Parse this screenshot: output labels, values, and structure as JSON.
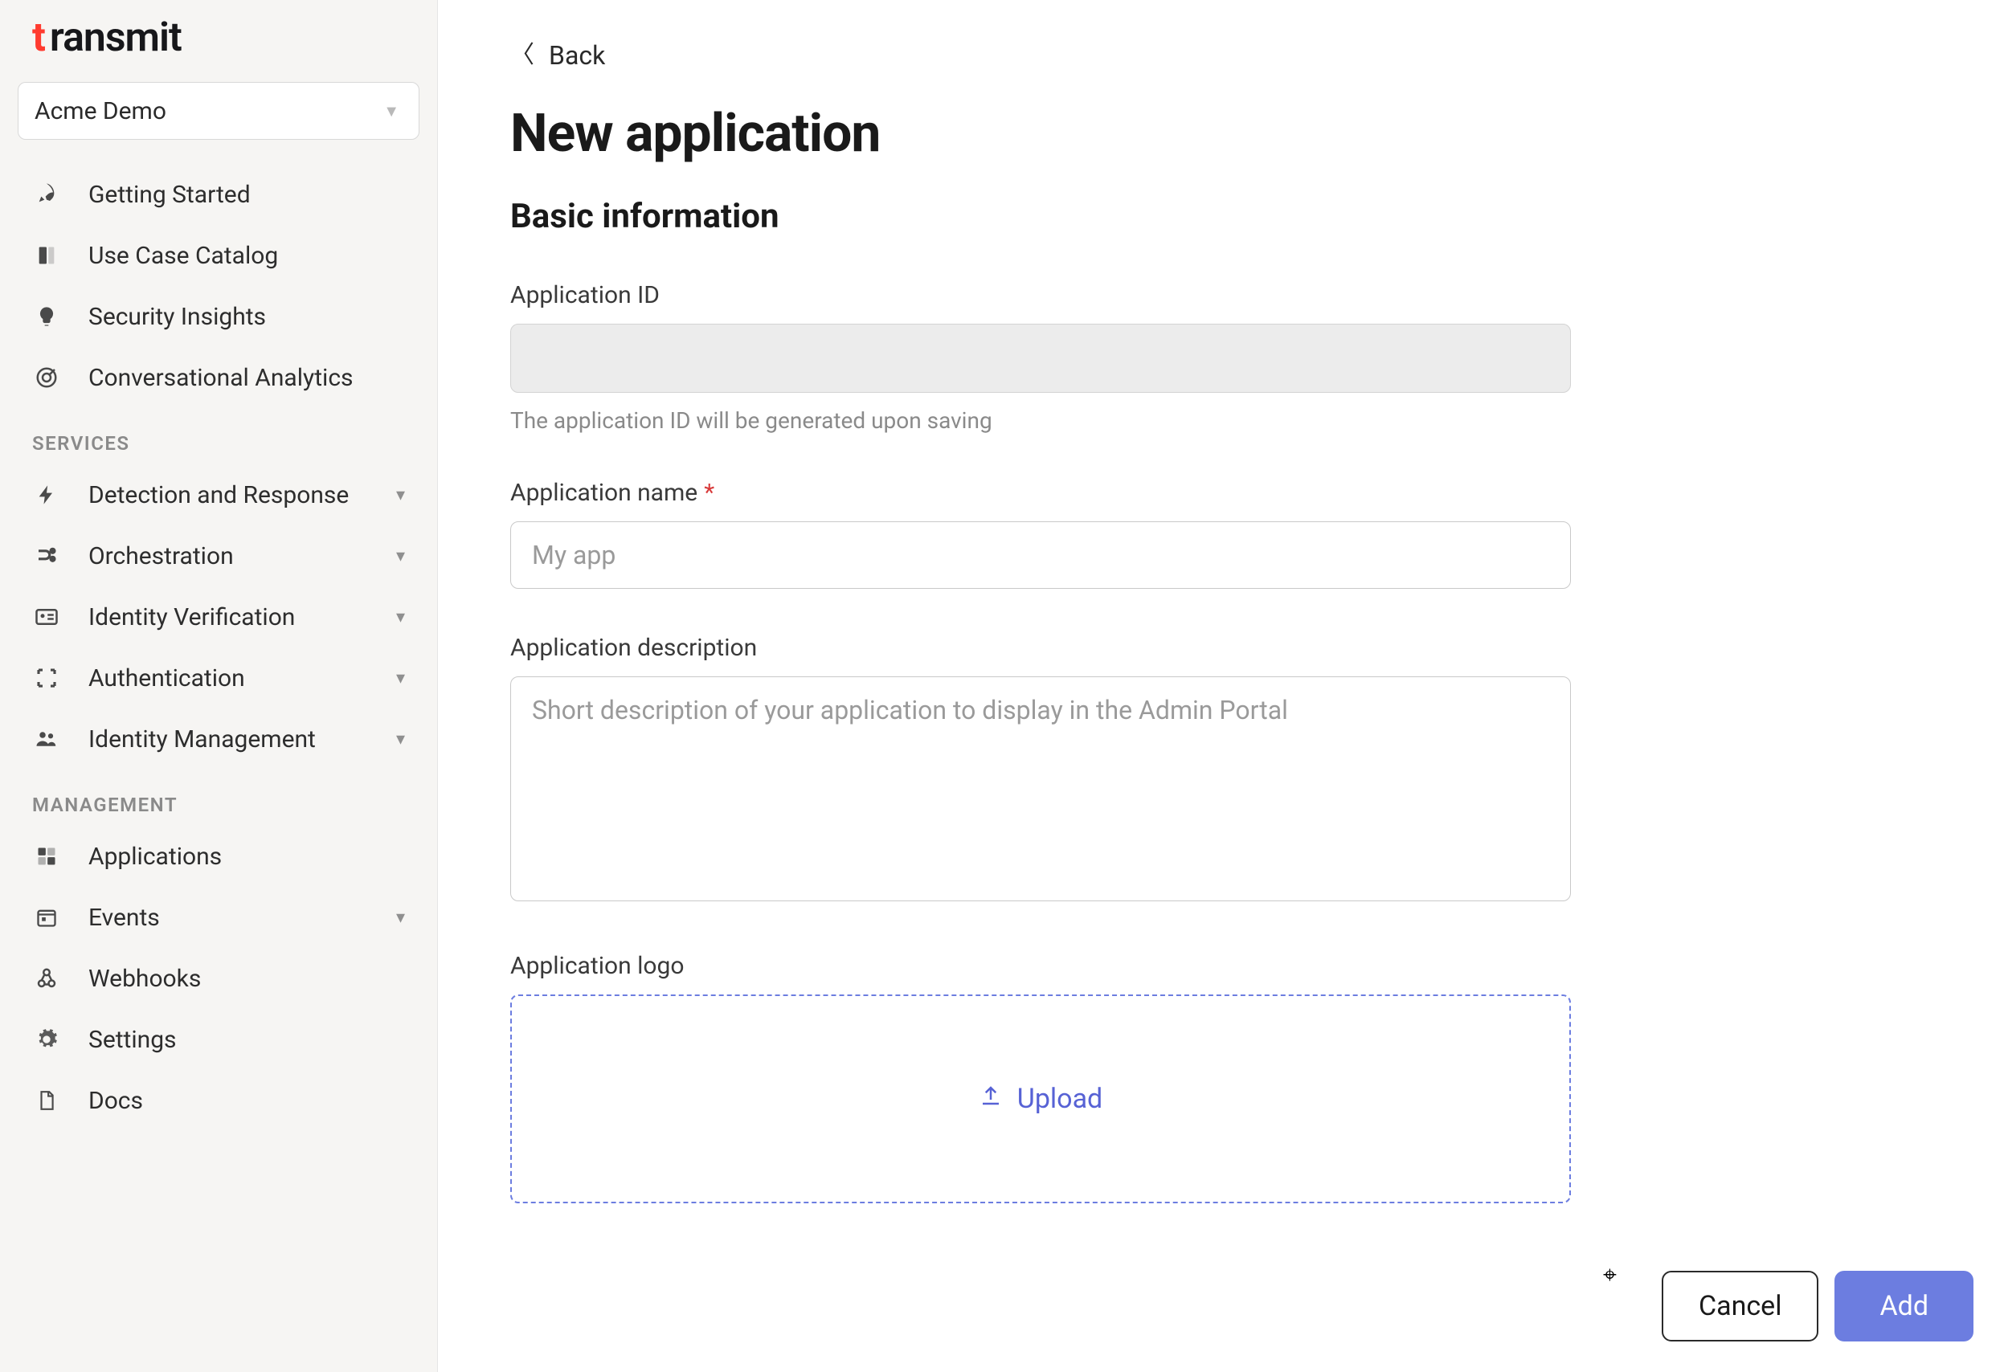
{
  "brand": {
    "name": "ransmit",
    "accent": "t"
  },
  "tenant": {
    "selected": "Acme Demo"
  },
  "sidebar": {
    "top": [
      {
        "label": "Getting Started"
      },
      {
        "label": "Use Case Catalog"
      },
      {
        "label": "Security Insights"
      },
      {
        "label": "Conversational Analytics"
      }
    ],
    "sections": [
      {
        "heading": "SERVICES",
        "items": [
          {
            "label": "Detection and Response",
            "expandable": true
          },
          {
            "label": "Orchestration",
            "expandable": true
          },
          {
            "label": "Identity Verification",
            "expandable": true
          },
          {
            "label": "Authentication",
            "expandable": true
          },
          {
            "label": "Identity Management",
            "expandable": true
          }
        ]
      },
      {
        "heading": "MANAGEMENT",
        "items": [
          {
            "label": "Applications",
            "expandable": false
          },
          {
            "label": "Events",
            "expandable": true
          },
          {
            "label": "Webhooks",
            "expandable": false
          },
          {
            "label": "Settings",
            "expandable": false
          },
          {
            "label": "Docs",
            "expandable": false
          }
        ]
      }
    ]
  },
  "page": {
    "back_label": "Back",
    "title": "New application",
    "section_title": "Basic information",
    "fields": {
      "app_id": {
        "label": "Application ID",
        "helper": "The application ID will be generated upon saving"
      },
      "app_name": {
        "label": "Application name",
        "placeholder": "My app"
      },
      "app_desc": {
        "label": "Application description",
        "placeholder": "Short description of your application to display in the Admin Portal"
      },
      "app_logo": {
        "label": "Application logo",
        "upload_label": "Upload"
      }
    },
    "actions": {
      "cancel": "Cancel",
      "add": "Add"
    }
  }
}
